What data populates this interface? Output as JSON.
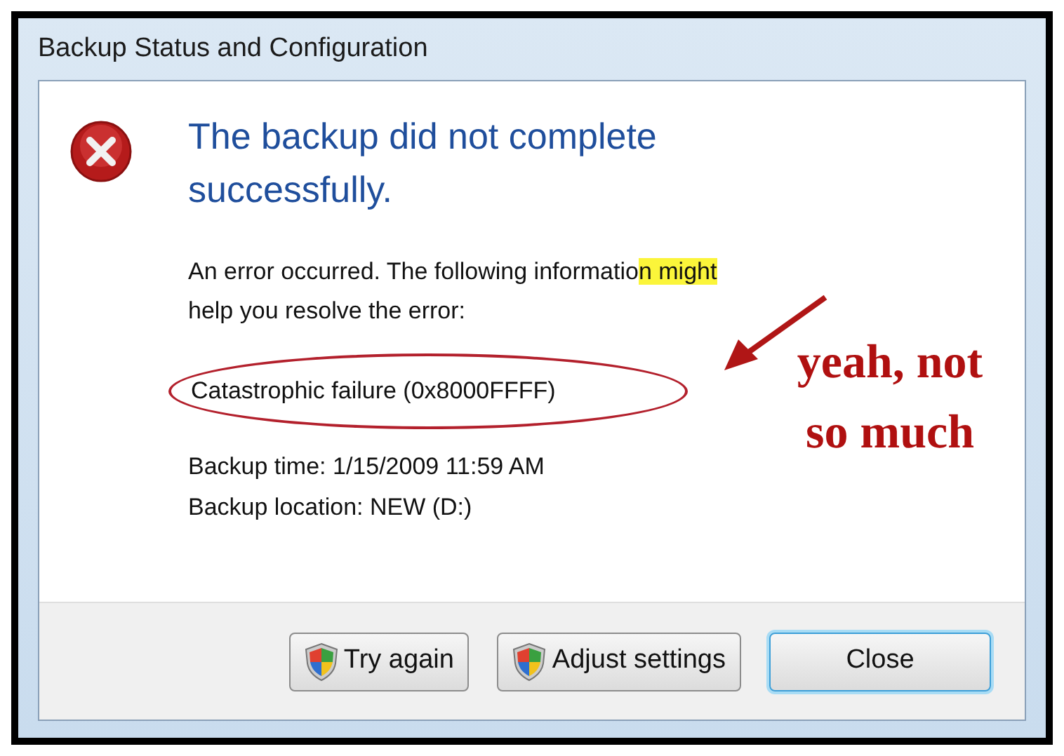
{
  "window": {
    "title": "Backup Status and Configuration"
  },
  "heading": "The backup did not complete successfully.",
  "message": {
    "before": "An error occurred. The following informatio",
    "highlighted": "n might",
    "after": "help you resolve the error:"
  },
  "error_detail": "Catastrophic failure (0x8000FFFF)",
  "details": [
    "Backup time: 1/15/2009 11:59 AM",
    "Backup location: NEW (D:)"
  ],
  "annotation": {
    "text": "yeah, not so much"
  },
  "buttons": [
    {
      "label": "Try again",
      "shield": true,
      "default": false
    },
    {
      "label": "Adjust settings",
      "shield": true,
      "default": false
    },
    {
      "label": "Close",
      "shield": false,
      "default": true
    }
  ]
}
